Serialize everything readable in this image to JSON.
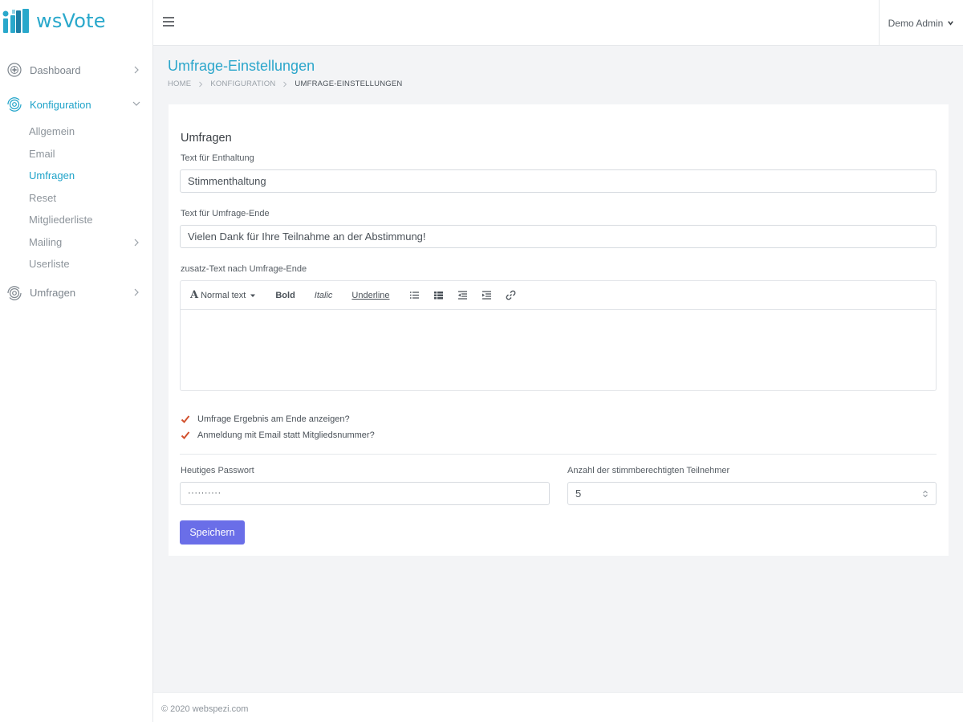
{
  "brand": {
    "name": "wsVote",
    "accent": "#29a8cb"
  },
  "header": {
    "user_name": "Demo Admin"
  },
  "sidebar": {
    "items": [
      {
        "label": "Dashboard",
        "icon": "dashboard-icon"
      },
      {
        "label": "Konfiguration",
        "icon": "settings-icon"
      },
      {
        "label": "Umfragen",
        "icon": "refresh-icon"
      }
    ],
    "sub_items": [
      {
        "label": "Allgemein"
      },
      {
        "label": "Email"
      },
      {
        "label": "Umfragen"
      },
      {
        "label": "Reset"
      },
      {
        "label": "Mitgliederliste"
      },
      {
        "label": "Mailing"
      },
      {
        "label": "Userliste"
      }
    ]
  },
  "page": {
    "title": "Umfrage-Einstellungen",
    "breadcrumb": [
      "HOME",
      "KONFIGURATION",
      "UMFRAGE-EINSTELLUNGEN"
    ]
  },
  "form": {
    "section_title": "Umfragen",
    "abstention_label": "Text für Enthaltung",
    "abstention_value": "Stimmenthaltung",
    "end_text_label": "Text für Umfrage-Ende",
    "end_text_value": "Vielen Dank für Ihre Teilnahme an der Abstimmung!",
    "extra_text_label": "zusatz-Text nach Umfrage-Ende",
    "editor_toolbar": {
      "format": "Normal text",
      "bold": "Bold",
      "italic": "Italic",
      "underline": "Underline"
    },
    "check_show_result": "Umfrage Ergebnis am Ende anzeigen?",
    "check_email_login": "Anmeldung mit Email statt Mitgliedsnummer?",
    "password_label": "Heutiges Passwort",
    "password_value": "··········",
    "participants_label": "Anzahl der stimmberechtigten Teilnehmer",
    "participants_value": "5",
    "save_label": "Speichern",
    "button_color": "#6a6ee8"
  },
  "footer": {
    "copyright": "© 2020 webspezi.com"
  }
}
